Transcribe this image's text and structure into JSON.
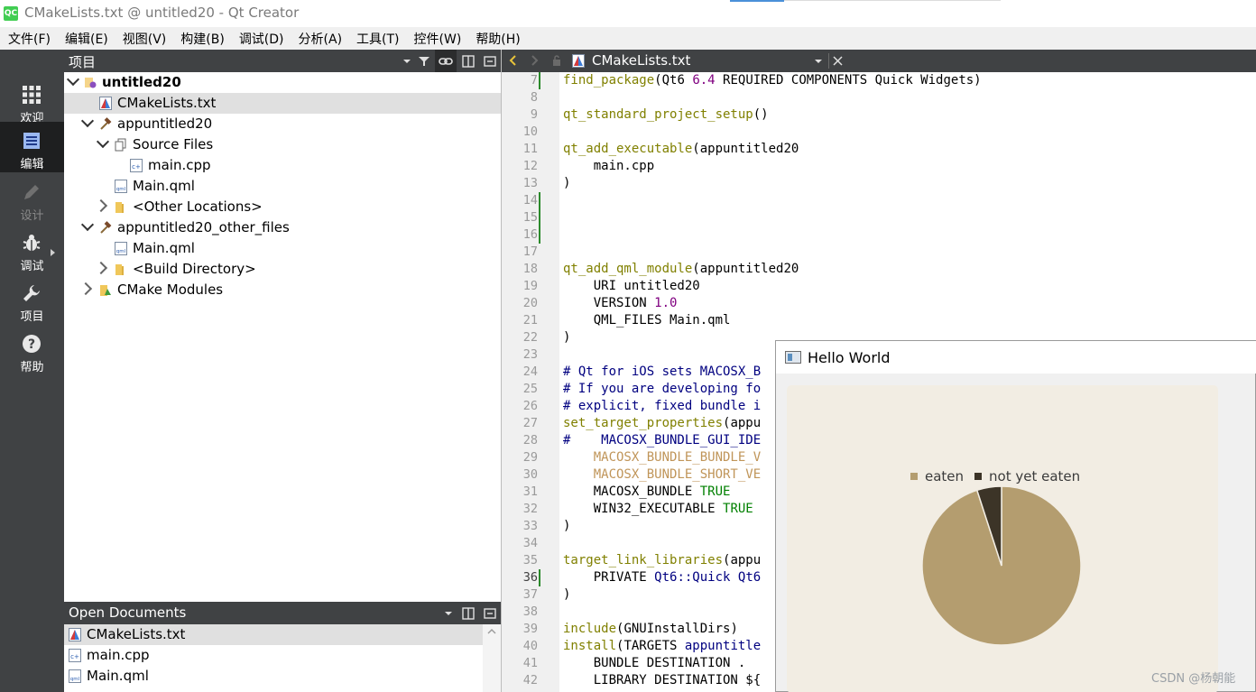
{
  "window": {
    "title": "CMakeLists.txt @ untitled20 - Qt Creator",
    "app_icon": "QC"
  },
  "menu": [
    "文件(F)",
    "编辑(E)",
    "视图(V)",
    "构建(B)",
    "调试(D)",
    "分析(A)",
    "工具(T)",
    "控件(W)",
    "帮助(H)"
  ],
  "modes": [
    {
      "label": "欢迎",
      "icon": "grid-icon",
      "state": "normal"
    },
    {
      "label": "编辑",
      "icon": "edit-document-icon",
      "state": "active"
    },
    {
      "label": "设计",
      "icon": "pencil-icon",
      "state": "disabled"
    },
    {
      "label": "调试",
      "icon": "bug-icon",
      "state": "normal"
    },
    {
      "label": "项目",
      "icon": "wrench-icon",
      "state": "normal"
    },
    {
      "label": "帮助",
      "icon": "help-icon",
      "state": "normal"
    }
  ],
  "project_panel": {
    "title": "项目",
    "tree": [
      {
        "label": "untitled20",
        "bold": true,
        "expanded": true,
        "icon": "project-root-icon"
      },
      {
        "label": "CMakeLists.txt",
        "selected": true,
        "icon": "cmake-file-icon"
      },
      {
        "label": "appuntitled20",
        "expanded": true,
        "icon": "hammer-icon"
      },
      {
        "label": "Source Files",
        "expanded": true,
        "icon": "sources-folder-icon"
      },
      {
        "label": "main.cpp",
        "icon": "cpp-file-icon"
      },
      {
        "label": "Main.qml",
        "icon": "qml-file-icon"
      },
      {
        "label": "<Other Locations>",
        "expanded": false,
        "icon": "folder-icon"
      },
      {
        "label": "appuntitled20_other_files",
        "expanded": true,
        "icon": "hammer-icon"
      },
      {
        "label": "Main.qml",
        "icon": "qml-file-icon"
      },
      {
        "label": "<Build Directory>",
        "expanded": false,
        "icon": "folder-icon"
      },
      {
        "label": "CMake Modules",
        "expanded": false,
        "icon": "cmake-modules-icon"
      }
    ]
  },
  "open_documents": {
    "title": "Open Documents",
    "items": [
      {
        "label": "CMakeLists.txt",
        "selected": true,
        "icon": "cmake-file-icon"
      },
      {
        "label": "main.cpp",
        "icon": "cpp-file-icon"
      },
      {
        "label": "Main.qml",
        "icon": "qml-file-icon"
      }
    ]
  },
  "editor": {
    "file_name": "CMakeLists.txt",
    "current_line": 36,
    "lines": [
      {
        "n": 7,
        "parts": [
          [
            "fn",
            "find_package"
          ],
          [
            "",
            "(Qt6 "
          ],
          [
            "num",
            "6.4"
          ],
          [
            "",
            " REQUIRED COMPONENTS Quick Widgets)"
          ]
        ]
      },
      {
        "n": 8,
        "parts": []
      },
      {
        "n": 9,
        "parts": [
          [
            "fn",
            "qt_standard_project_setup"
          ],
          [
            "",
            "()"
          ]
        ]
      },
      {
        "n": 10,
        "parts": []
      },
      {
        "n": 11,
        "parts": [
          [
            "fn",
            "qt_add_executable"
          ],
          [
            "",
            "(appuntitled20"
          ]
        ]
      },
      {
        "n": 12,
        "parts": [
          [
            "",
            "    main.cpp"
          ]
        ]
      },
      {
        "n": 13,
        "parts": [
          [
            "",
            ")"
          ]
        ]
      },
      {
        "n": 14,
        "parts": []
      },
      {
        "n": 15,
        "parts": []
      },
      {
        "n": 16,
        "parts": []
      },
      {
        "n": 17,
        "parts": []
      },
      {
        "n": 18,
        "parts": [
          [
            "fn",
            "qt_add_qml_module"
          ],
          [
            "",
            "(appuntitled20"
          ]
        ]
      },
      {
        "n": 19,
        "parts": [
          [
            "",
            "    URI untitled20"
          ]
        ]
      },
      {
        "n": 20,
        "parts": [
          [
            "",
            "    VERSION "
          ],
          [
            "num",
            "1.0"
          ]
        ]
      },
      {
        "n": 21,
        "parts": [
          [
            "",
            "    QML_FILES Main.qml"
          ]
        ]
      },
      {
        "n": 22,
        "parts": [
          [
            "",
            ")"
          ]
        ]
      },
      {
        "n": 23,
        "parts": []
      },
      {
        "n": 24,
        "parts": [
          [
            "cmt",
            "# Qt for iOS sets MACOSX_B"
          ]
        ]
      },
      {
        "n": 25,
        "parts": [
          [
            "cmt",
            "# If you are developing fo"
          ]
        ]
      },
      {
        "n": 26,
        "parts": [
          [
            "cmt",
            "# explicit, fixed bundle i"
          ]
        ]
      },
      {
        "n": 27,
        "parts": [
          [
            "fn",
            "set_target_properties"
          ],
          [
            "",
            "(appu"
          ]
        ]
      },
      {
        "n": 28,
        "parts": [
          [
            "cmt",
            "#    MACOSX_BUNDLE_GUI_IDE"
          ]
        ]
      },
      {
        "n": 29,
        "parts": [
          [
            "",
            "    "
          ],
          [
            "var",
            "MACOSX_BUNDLE_BUNDLE_V"
          ]
        ]
      },
      {
        "n": 30,
        "parts": [
          [
            "",
            "    "
          ],
          [
            "var",
            "MACOSX_BUNDLE_SHORT_VE"
          ]
        ]
      },
      {
        "n": 31,
        "parts": [
          [
            "",
            "    MACOSX_BUNDLE "
          ],
          [
            "kw",
            "TRUE"
          ]
        ]
      },
      {
        "n": 32,
        "parts": [
          [
            "",
            "    WIN32_EXECUTABLE "
          ],
          [
            "kw",
            "TRUE"
          ]
        ]
      },
      {
        "n": 33,
        "parts": [
          [
            "",
            ")"
          ]
        ]
      },
      {
        "n": 34,
        "parts": []
      },
      {
        "n": 35,
        "parts": [
          [
            "fn",
            "target_link_libraries"
          ],
          [
            "",
            "(appu"
          ]
        ]
      },
      {
        "n": 36,
        "parts": [
          [
            "",
            "    PRIVATE "
          ],
          [
            "tp",
            "Qt6::Quick"
          ],
          [
            "",
            " "
          ],
          [
            "tp",
            "Qt6"
          ]
        ]
      },
      {
        "n": 37,
        "parts": [
          [
            "",
            ")"
          ]
        ]
      },
      {
        "n": 38,
        "parts": []
      },
      {
        "n": 39,
        "parts": [
          [
            "fn",
            "include"
          ],
          [
            "",
            "(GNUInstallDirs)"
          ]
        ]
      },
      {
        "n": 40,
        "parts": [
          [
            "fn",
            "install"
          ],
          [
            "",
            "(TARGETS "
          ],
          [
            "tp",
            "appuntitle"
          ]
        ]
      },
      {
        "n": 41,
        "parts": [
          [
            "",
            "    BUNDLE DESTINATION ."
          ]
        ]
      },
      {
        "n": 42,
        "parts": [
          [
            "",
            "    LIBRARY DESTINATION ${"
          ]
        ]
      }
    ]
  },
  "hello_window": {
    "title": "Hello World"
  },
  "chart_data": {
    "type": "pie",
    "series": [
      {
        "values": [
          95,
          5
        ]
      }
    ],
    "categories": [
      "eaten",
      "not yet eaten"
    ],
    "colors": [
      "#b49d6f",
      "#3c3427"
    ],
    "legend": "top"
  },
  "watermark": "CSDN @杨朝能"
}
